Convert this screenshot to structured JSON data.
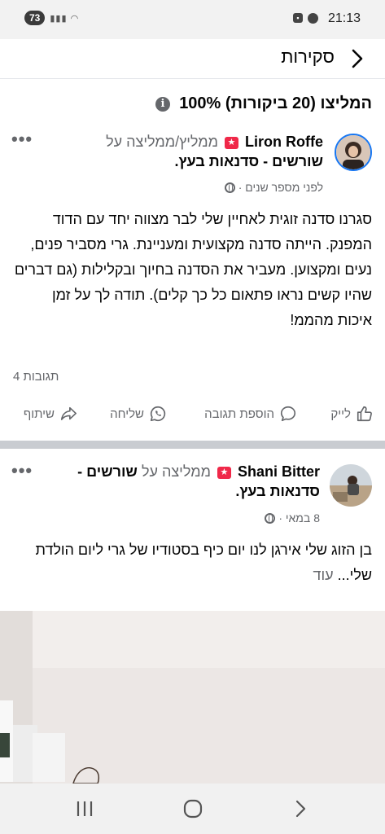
{
  "status": {
    "battery": "73",
    "time": "21:13"
  },
  "header": {
    "title": "סקירות"
  },
  "summary": {
    "text": "100% המליצו (20 ביקורות)"
  },
  "posts": [
    {
      "author": "Liron Roffe",
      "recommends": "ממליץ/ממליצה על",
      "page": "שורשים - סדנאות בעץ",
      "time": "לפני מספר שנים ·",
      "text": "סגרנו סדנה זוגית לאחיין שלי לבר מצווה יחד עם הדוד המפנק. הייתה סדנה מקצועית ומעניינת. גרי מסביר פנים, נעים ומקצוען. מעביר את הסדנה בחיוך ובקלילות (גם דברים שהיו קשים נראו פתאום כל כך קלים). תודה לך על זמן איכות מהממ!",
      "comments": "4 תגובות"
    },
    {
      "author": "Shani Bitter",
      "recommends": "ממליצה על",
      "page": "שורשים - סדנאות בעץ",
      "time": "8 במאי ·",
      "text": "בן הזוג שלי אירגן לנו יום כיף בסטודיו של גרי ליום הולדת שלי...",
      "more": "עוד"
    }
  ],
  "actions": {
    "like": "לייק",
    "comment": "הוספת תגובה",
    "send": "שליחה",
    "share": "שיתוף"
  },
  "colors": {
    "badge": "#f02849",
    "secondary_text": "#65676b",
    "avatar_ring": "#1877f2"
  }
}
